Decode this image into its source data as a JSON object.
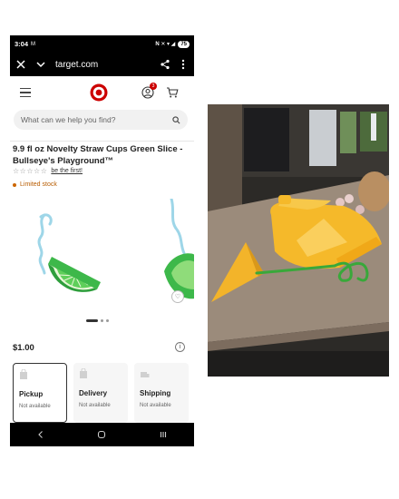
{
  "status": {
    "time": "3:04",
    "misc": "M",
    "icons": "N ✕ ▾ ◢",
    "battery": "75"
  },
  "browser": {
    "url": "target.com",
    "close_icon": "close-icon",
    "chevron_icon": "chevron-down-icon",
    "share_icon": "share-icon",
    "menu_icon": "more-vert-icon"
  },
  "header": {
    "account_badge": "3"
  },
  "search": {
    "placeholder": "What can we help you find?"
  },
  "product": {
    "title": "9.9 fl oz Novelty Straw Cups Green Slice - Bullseye's Playground™",
    "stars": "☆☆☆☆☆",
    "review_link": "be the first!",
    "stock": "Limited stock",
    "price": "$1.00"
  },
  "fulfillment": [
    {
      "name": "Pickup",
      "status": "Not available"
    },
    {
      "name": "Delivery",
      "status": "Not available"
    },
    {
      "name": "Shipping",
      "status": "Not available"
    }
  ],
  "colors": {
    "brand": "#cc0000",
    "lime": "#3db84a",
    "lemon": "#f5b92a",
    "straw": "#9ed6e8"
  }
}
